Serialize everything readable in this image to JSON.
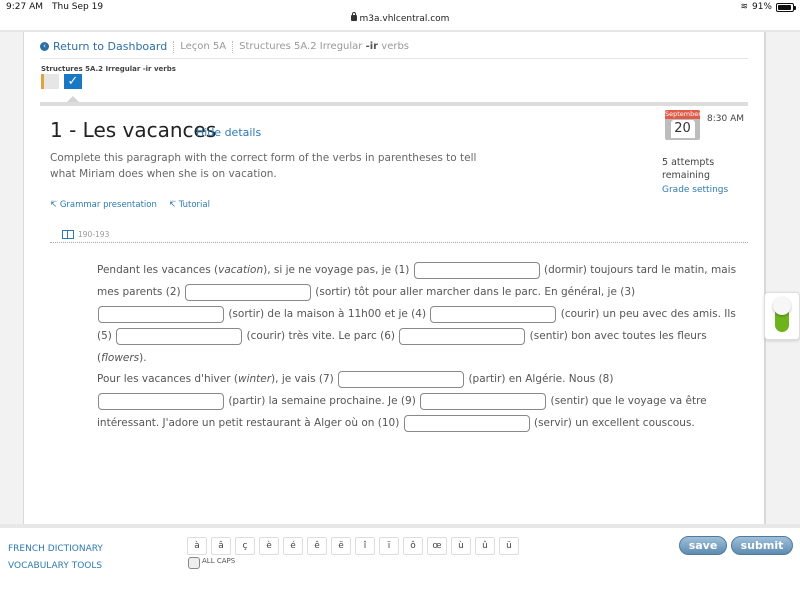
{
  "status_bar": {
    "time": "9:27 AM",
    "date": "Thu Sep 19",
    "battery": "91%",
    "battery_level": 0.91
  },
  "browser": {
    "url": "m3a.vhlcentral.com"
  },
  "breadcrumb": {
    "back_label": "Return to Dashboard",
    "lesson": "Leçon 5A",
    "section_prefix": "Structures 5A.2 Irregular ",
    "section_bold": "-ir",
    "section_suffix": " verbs"
  },
  "assignment": {
    "label": "Structures 5A.2 Irregular -ir verbs",
    "tiles": [
      {
        "state": "incomplete"
      },
      {
        "state": "complete",
        "glyph": "✓"
      }
    ]
  },
  "activity": {
    "title": "1 - Les vacances",
    "hide_details": "Hide details",
    "instructions": "Complete this paragraph with the correct form of the verbs in parentheses to tell what Miriam does when she is on vacation.",
    "links": [
      {
        "icon": "↸",
        "label": "Grammar presentation"
      },
      {
        "icon": "↸",
        "label": "Tutorial"
      }
    ],
    "pages": "190-193"
  },
  "due": {
    "month": "September",
    "day": "20",
    "time": "8:30 AM"
  },
  "attempts": "5 attempts remaining",
  "grade_settings": "Grade settings",
  "paragraph1": {
    "t0": "Pendant les vacances (",
    "t0i": "vacation",
    "t0b": "), si je ne voyage pas, je (1) ",
    "t1": " (dormir) toujours tard le matin, mais mes parents (2) ",
    "t2": " (sortir) tôt pour aller marcher dans le parc. En général, je (3) ",
    "t3": " (sortir) de la maison à 11h00 et je (4) ",
    "t4": " (courir) un peu avec des amis. Ils (5) ",
    "t5": " (courir) très vite. Le parc (6) ",
    "t6": " (sentir) bon avec toutes les fleurs (",
    "t6i": "flowers",
    "t6b": ")."
  },
  "paragraph2": {
    "t0": "Pour les vacances d'hiver (",
    "t0i": "winter",
    "t0b": "), je vais (7) ",
    "t1": " (partir) en Algérie. Nous (8) ",
    "t2": " (partir) la semaine prochaine. Je (9) ",
    "t3": " (sentir) que le voyage va être intéressant. J'adore un petit restaurant à Alger où on (10) ",
    "t4": " (servir) un excellent couscous."
  },
  "blanks": [
    "",
    "",
    "",
    "",
    "",
    "",
    "",
    "",
    "",
    ""
  ],
  "footer": {
    "dictionary": "FRENCH DICTIONARY",
    "vocab": "VOCABULARY TOOLS",
    "chars": [
      "à",
      "â",
      "ç",
      "è",
      "é",
      "ê",
      "ë",
      "î",
      "ï",
      "ô",
      "œ",
      "ù",
      "û",
      "ü"
    ],
    "all_caps": "ALL CAPS",
    "save": "save",
    "submit": "submit"
  },
  "colors": {
    "link": "#2e7ab0",
    "check_tile": "#1a78c2",
    "calendar_month": "#e05a48",
    "toggle": "#6cb31c"
  }
}
